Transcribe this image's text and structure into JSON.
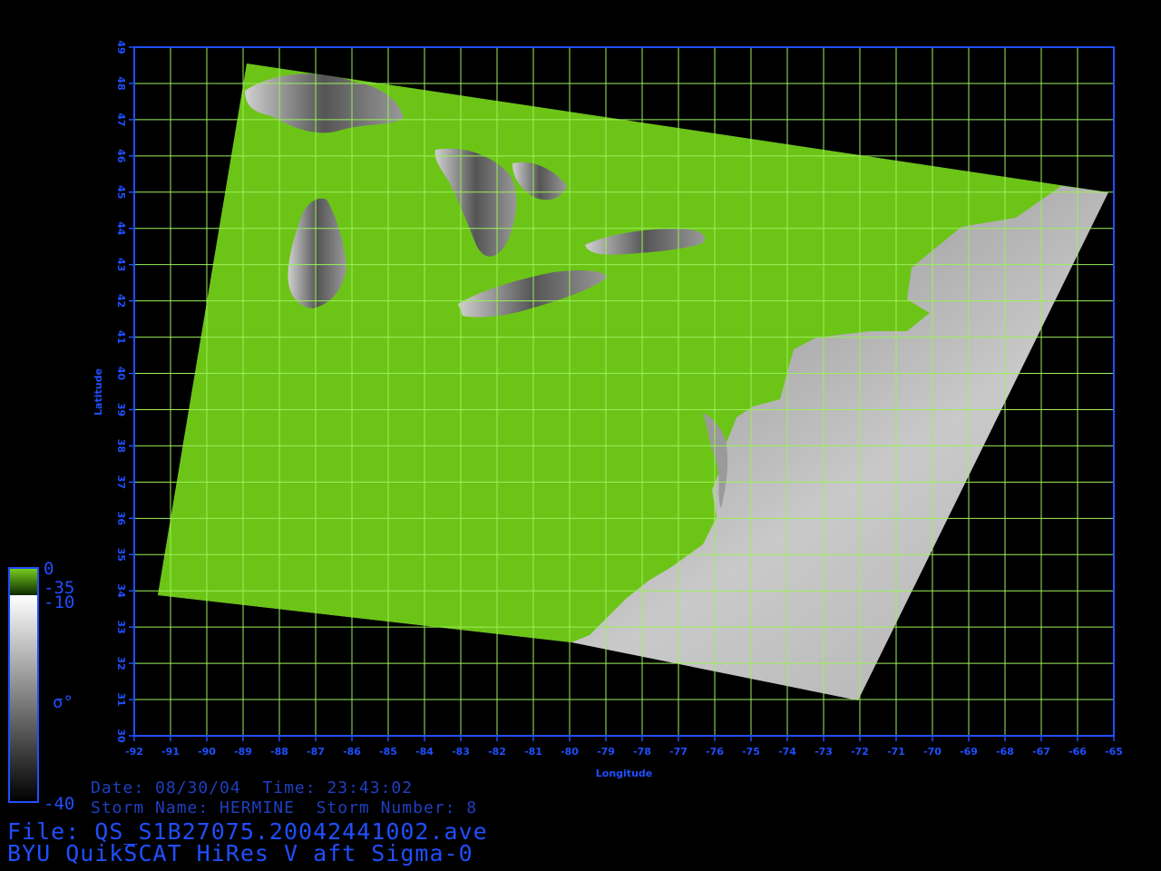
{
  "colors": {
    "background": "#000000",
    "frame": "#1f4fff",
    "grid": "#9bf05a",
    "land": "#6cc417",
    "text": "#1f4fff"
  },
  "axes": {
    "x_label": "Longitude",
    "y_label": "Latitude",
    "lon_ticks": [
      "-92",
      "-91",
      "-90",
      "-89",
      "-88",
      "-87",
      "-86",
      "-85",
      "-84",
      "-83",
      "-82",
      "-81",
      "-80",
      "-79",
      "-78",
      "-77",
      "-76",
      "-75",
      "-74",
      "-73",
      "-72",
      "-71",
      "-70",
      "-69",
      "-68",
      "-67",
      "-66",
      "-65"
    ],
    "lat_ticks": [
      "30",
      "31",
      "32",
      "33",
      "34",
      "35",
      "36",
      "37",
      "38",
      "39",
      "40",
      "41",
      "42",
      "43",
      "44",
      "45",
      "46",
      "47",
      "48",
      "49"
    ],
    "lon_range": [
      -92,
      -65
    ],
    "lat_range": [
      30,
      49
    ]
  },
  "colorbar": {
    "land_max": "0",
    "land_min": "-35",
    "ocean_max": "-10",
    "ocean_min": "-40",
    "symbol": "σ°"
  },
  "info": {
    "date_line": "Date: 08/30/04  Time: 23:43:02",
    "storm_line": "Storm Name: HERMINE  Storm Number: 8",
    "file_line": "File: QS_S1B27075.20042441002.ave",
    "product_line": "BYU QuikSCAT HiRes V aft Sigma-0"
  }
}
